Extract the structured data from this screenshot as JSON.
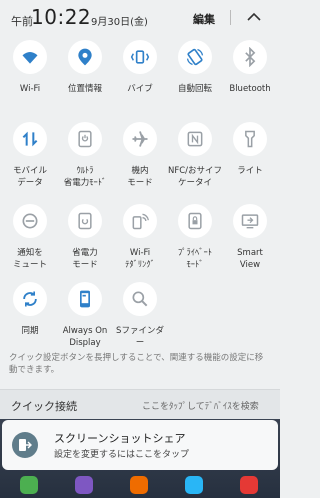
{
  "header": {
    "ampm": "午前",
    "time": "10:22",
    "date": "9月30日(金)",
    "edit_label": "編集"
  },
  "tiles": [
    {
      "label": "Wi-Fi",
      "icon": "wifi-icon"
    },
    {
      "label": "位置情報",
      "icon": "location-pin-icon"
    },
    {
      "label": "バイブ",
      "icon": "vibrate-icon"
    },
    {
      "label": "自動回転",
      "icon": "auto-rotate-icon"
    },
    {
      "label": "Bluetooth",
      "icon": "bluetooth-icon"
    },
    {
      "label": "モバイル\nデータ",
      "icon": "mobile-data-icon"
    },
    {
      "label": "ｳﾙﾄﾗ\n省電力ﾓｰﾄﾞ",
      "icon": "ultra-power-saving-icon"
    },
    {
      "label": "機内\nモード",
      "icon": "airplane-icon"
    },
    {
      "label": "NFC/おサイフ\nケータイ",
      "icon": "nfc-icon"
    },
    {
      "label": "ライト",
      "icon": "flashlight-icon"
    },
    {
      "label": "通知を\nミュート",
      "icon": "mute-notifications-icon"
    },
    {
      "label": "省電力\nモード",
      "icon": "power-saving-icon"
    },
    {
      "label": "Wi-Fi\nﾃﾀﾞﾘﾝｸﾞ",
      "icon": "wifi-tethering-icon"
    },
    {
      "label": "ﾌﾟﾗｲﾍﾞｰﾄ\nﾓｰﾄﾞ",
      "icon": "private-mode-icon"
    },
    {
      "label": "Smart\nView",
      "icon": "smart-view-icon"
    },
    {
      "label": "同期",
      "icon": "sync-icon"
    },
    {
      "label": "Always On\nDisplay",
      "icon": "always-on-display-icon"
    },
    {
      "label": "Sファインダー",
      "icon": "s-finder-icon"
    }
  ],
  "hint_text": "クイック設定ボタンを長押しすることで、関連する機能の設定に移動できます。",
  "quick_connect": {
    "title": "クイック接続",
    "hint": "ここをﾀｯﾌﾟしてﾃﾞﾊﾞｲｽを検索"
  },
  "notification": {
    "title": "スクリーンショットシェア",
    "subtitle": "設定を変更するにはここをタップ"
  },
  "colors": {
    "accent": "#2f80c9",
    "panel_bg": "#eef0f1",
    "tile_bg": "#ffffff"
  }
}
